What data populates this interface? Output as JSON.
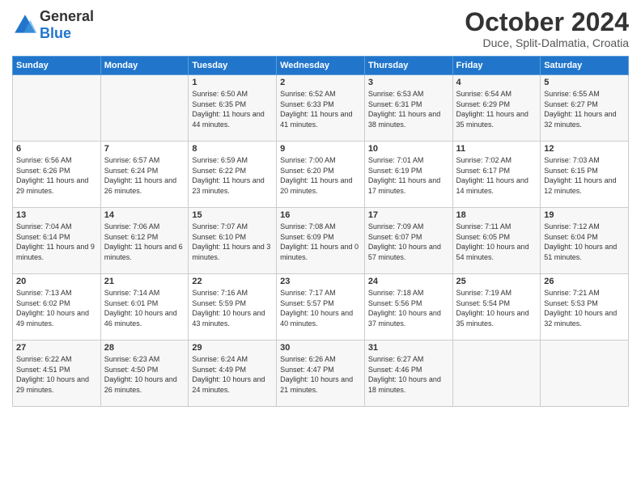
{
  "header": {
    "logo": {
      "text_general": "General",
      "text_blue": "Blue"
    },
    "title": "October 2024",
    "location": "Duce, Split-Dalmatia, Croatia"
  },
  "calendar": {
    "days_of_week": [
      "Sunday",
      "Monday",
      "Tuesday",
      "Wednesday",
      "Thursday",
      "Friday",
      "Saturday"
    ],
    "weeks": [
      [
        {
          "day": "",
          "sunrise": "",
          "sunset": "",
          "daylight": ""
        },
        {
          "day": "",
          "sunrise": "",
          "sunset": "",
          "daylight": ""
        },
        {
          "day": "1",
          "sunrise": "Sunrise: 6:50 AM",
          "sunset": "Sunset: 6:35 PM",
          "daylight": "Daylight: 11 hours and 44 minutes."
        },
        {
          "day": "2",
          "sunrise": "Sunrise: 6:52 AM",
          "sunset": "Sunset: 6:33 PM",
          "daylight": "Daylight: 11 hours and 41 minutes."
        },
        {
          "day": "3",
          "sunrise": "Sunrise: 6:53 AM",
          "sunset": "Sunset: 6:31 PM",
          "daylight": "Daylight: 11 hours and 38 minutes."
        },
        {
          "day": "4",
          "sunrise": "Sunrise: 6:54 AM",
          "sunset": "Sunset: 6:29 PM",
          "daylight": "Daylight: 11 hours and 35 minutes."
        },
        {
          "day": "5",
          "sunrise": "Sunrise: 6:55 AM",
          "sunset": "Sunset: 6:27 PM",
          "daylight": "Daylight: 11 hours and 32 minutes."
        }
      ],
      [
        {
          "day": "6",
          "sunrise": "Sunrise: 6:56 AM",
          "sunset": "Sunset: 6:26 PM",
          "daylight": "Daylight: 11 hours and 29 minutes."
        },
        {
          "day": "7",
          "sunrise": "Sunrise: 6:57 AM",
          "sunset": "Sunset: 6:24 PM",
          "daylight": "Daylight: 11 hours and 26 minutes."
        },
        {
          "day": "8",
          "sunrise": "Sunrise: 6:59 AM",
          "sunset": "Sunset: 6:22 PM",
          "daylight": "Daylight: 11 hours and 23 minutes."
        },
        {
          "day": "9",
          "sunrise": "Sunrise: 7:00 AM",
          "sunset": "Sunset: 6:20 PM",
          "daylight": "Daylight: 11 hours and 20 minutes."
        },
        {
          "day": "10",
          "sunrise": "Sunrise: 7:01 AM",
          "sunset": "Sunset: 6:19 PM",
          "daylight": "Daylight: 11 hours and 17 minutes."
        },
        {
          "day": "11",
          "sunrise": "Sunrise: 7:02 AM",
          "sunset": "Sunset: 6:17 PM",
          "daylight": "Daylight: 11 hours and 14 minutes."
        },
        {
          "day": "12",
          "sunrise": "Sunrise: 7:03 AM",
          "sunset": "Sunset: 6:15 PM",
          "daylight": "Daylight: 11 hours and 12 minutes."
        }
      ],
      [
        {
          "day": "13",
          "sunrise": "Sunrise: 7:04 AM",
          "sunset": "Sunset: 6:14 PM",
          "daylight": "Daylight: 11 hours and 9 minutes."
        },
        {
          "day": "14",
          "sunrise": "Sunrise: 7:06 AM",
          "sunset": "Sunset: 6:12 PM",
          "daylight": "Daylight: 11 hours and 6 minutes."
        },
        {
          "day": "15",
          "sunrise": "Sunrise: 7:07 AM",
          "sunset": "Sunset: 6:10 PM",
          "daylight": "Daylight: 11 hours and 3 minutes."
        },
        {
          "day": "16",
          "sunrise": "Sunrise: 7:08 AM",
          "sunset": "Sunset: 6:09 PM",
          "daylight": "Daylight: 11 hours and 0 minutes."
        },
        {
          "day": "17",
          "sunrise": "Sunrise: 7:09 AM",
          "sunset": "Sunset: 6:07 PM",
          "daylight": "Daylight: 10 hours and 57 minutes."
        },
        {
          "day": "18",
          "sunrise": "Sunrise: 7:11 AM",
          "sunset": "Sunset: 6:05 PM",
          "daylight": "Daylight: 10 hours and 54 minutes."
        },
        {
          "day": "19",
          "sunrise": "Sunrise: 7:12 AM",
          "sunset": "Sunset: 6:04 PM",
          "daylight": "Daylight: 10 hours and 51 minutes."
        }
      ],
      [
        {
          "day": "20",
          "sunrise": "Sunrise: 7:13 AM",
          "sunset": "Sunset: 6:02 PM",
          "daylight": "Daylight: 10 hours and 49 minutes."
        },
        {
          "day": "21",
          "sunrise": "Sunrise: 7:14 AM",
          "sunset": "Sunset: 6:01 PM",
          "daylight": "Daylight: 10 hours and 46 minutes."
        },
        {
          "day": "22",
          "sunrise": "Sunrise: 7:16 AM",
          "sunset": "Sunset: 5:59 PM",
          "daylight": "Daylight: 10 hours and 43 minutes."
        },
        {
          "day": "23",
          "sunrise": "Sunrise: 7:17 AM",
          "sunset": "Sunset: 5:57 PM",
          "daylight": "Daylight: 10 hours and 40 minutes."
        },
        {
          "day": "24",
          "sunrise": "Sunrise: 7:18 AM",
          "sunset": "Sunset: 5:56 PM",
          "daylight": "Daylight: 10 hours and 37 minutes."
        },
        {
          "day": "25",
          "sunrise": "Sunrise: 7:19 AM",
          "sunset": "Sunset: 5:54 PM",
          "daylight": "Daylight: 10 hours and 35 minutes."
        },
        {
          "day": "26",
          "sunrise": "Sunrise: 7:21 AM",
          "sunset": "Sunset: 5:53 PM",
          "daylight": "Daylight: 10 hours and 32 minutes."
        }
      ],
      [
        {
          "day": "27",
          "sunrise": "Sunrise: 6:22 AM",
          "sunset": "Sunset: 4:51 PM",
          "daylight": "Daylight: 10 hours and 29 minutes."
        },
        {
          "day": "28",
          "sunrise": "Sunrise: 6:23 AM",
          "sunset": "Sunset: 4:50 PM",
          "daylight": "Daylight: 10 hours and 26 minutes."
        },
        {
          "day": "29",
          "sunrise": "Sunrise: 6:24 AM",
          "sunset": "Sunset: 4:49 PM",
          "daylight": "Daylight: 10 hours and 24 minutes."
        },
        {
          "day": "30",
          "sunrise": "Sunrise: 6:26 AM",
          "sunset": "Sunset: 4:47 PM",
          "daylight": "Daylight: 10 hours and 21 minutes."
        },
        {
          "day": "31",
          "sunrise": "Sunrise: 6:27 AM",
          "sunset": "Sunset: 4:46 PM",
          "daylight": "Daylight: 10 hours and 18 minutes."
        },
        {
          "day": "",
          "sunrise": "",
          "sunset": "",
          "daylight": ""
        },
        {
          "day": "",
          "sunrise": "",
          "sunset": "",
          "daylight": ""
        }
      ]
    ]
  }
}
